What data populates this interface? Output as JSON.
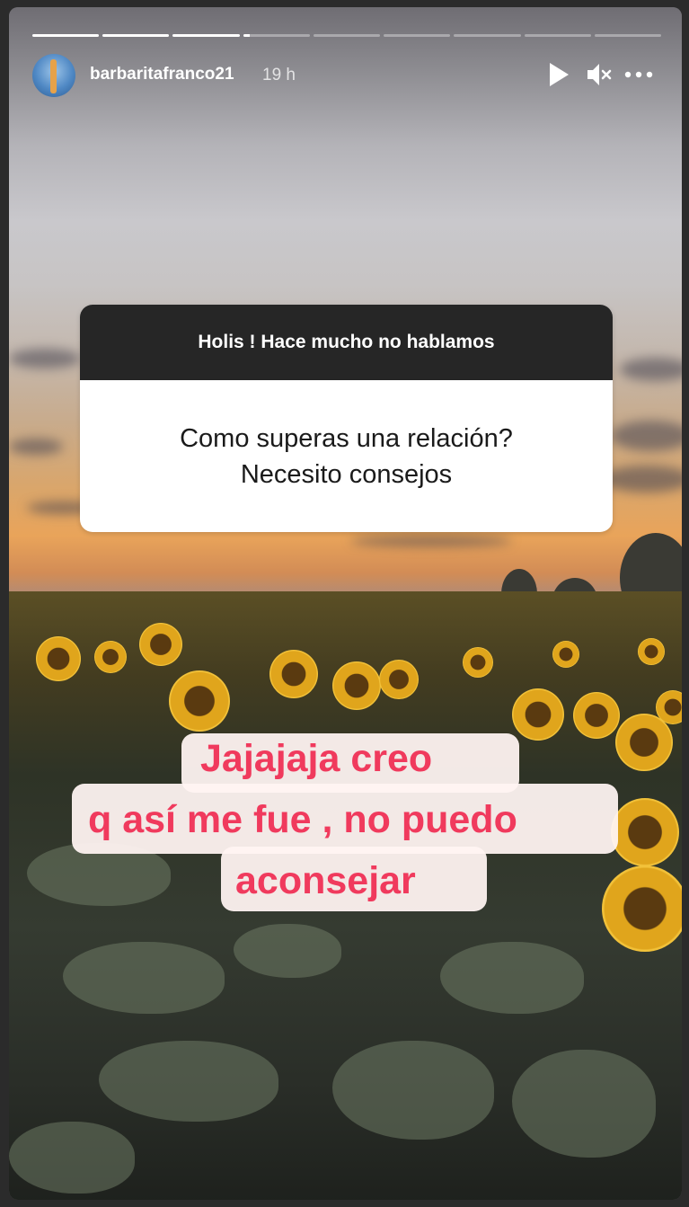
{
  "story": {
    "username": "barbaritafranco21",
    "time_ago": "19 h",
    "progress": {
      "segments": 9,
      "active_index": 3,
      "active_fraction": 0.1
    },
    "controls": {
      "play_icon": "play-icon",
      "mute_icon": "speaker-muted-icon",
      "more_icon": "more-horizontal-icon"
    }
  },
  "question_sticker": {
    "prompt": "Holis ! Hace mucho no hablamos",
    "lines": [
      "Como superas una relación?",
      "Necesito consejos"
    ]
  },
  "reply_text": {
    "lines": [
      "Jajajaja creo",
      "q así me fue , no puedo",
      "aconsejar"
    ],
    "color": "#f03a5d"
  }
}
